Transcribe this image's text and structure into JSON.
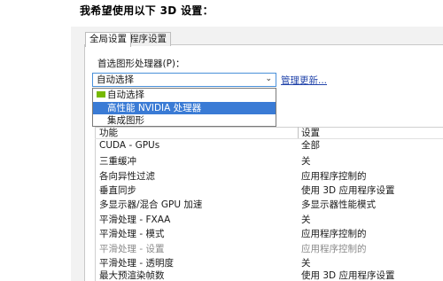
{
  "heading": "我希望使用以下 3D 设置：",
  "tabs": [
    {
      "label": "全局设置",
      "active": true
    },
    {
      "label": "程序设置",
      "active": false
    }
  ],
  "processor_label": "首选图形处理器(P)：",
  "dropdown": {
    "value": "自动选择",
    "options": [
      "自动选择",
      "高性能 NVIDIA 处理器",
      "集成图形"
    ],
    "highlighted_index": 1
  },
  "manage_link": "管理更新...",
  "table": {
    "headers": {
      "feature": "功能",
      "setting": "设置"
    },
    "rows": [
      {
        "feature": "CUDA - GPUs",
        "setting": "全部"
      },
      {
        "feature": "三重缓冲",
        "setting": "关"
      },
      {
        "feature": "各向异性过滤",
        "setting": "应用程序控制的"
      },
      {
        "feature": "垂直同步",
        "setting": "使用 3D 应用程序设置"
      },
      {
        "feature": "多显示器/混合 GPU 加速",
        "setting": "多显示器性能模式"
      },
      {
        "feature": "平滑处理 - FXAA",
        "setting": "关"
      },
      {
        "feature": "平滑处理 - 模式",
        "setting": "应用程序控制的"
      },
      {
        "feature": "平滑处理 - 设置",
        "setting": "应用程序控制的",
        "disabled": true
      },
      {
        "feature": "平滑处理 - 透明度",
        "setting": "关"
      },
      {
        "feature": "最大预渲染帧数",
        "setting": "使用 3D 应用程序设置"
      }
    ]
  },
  "colors": {
    "highlight": "#3a7bd5",
    "link": "#2244aa",
    "nvidia_green": "#76b900"
  }
}
